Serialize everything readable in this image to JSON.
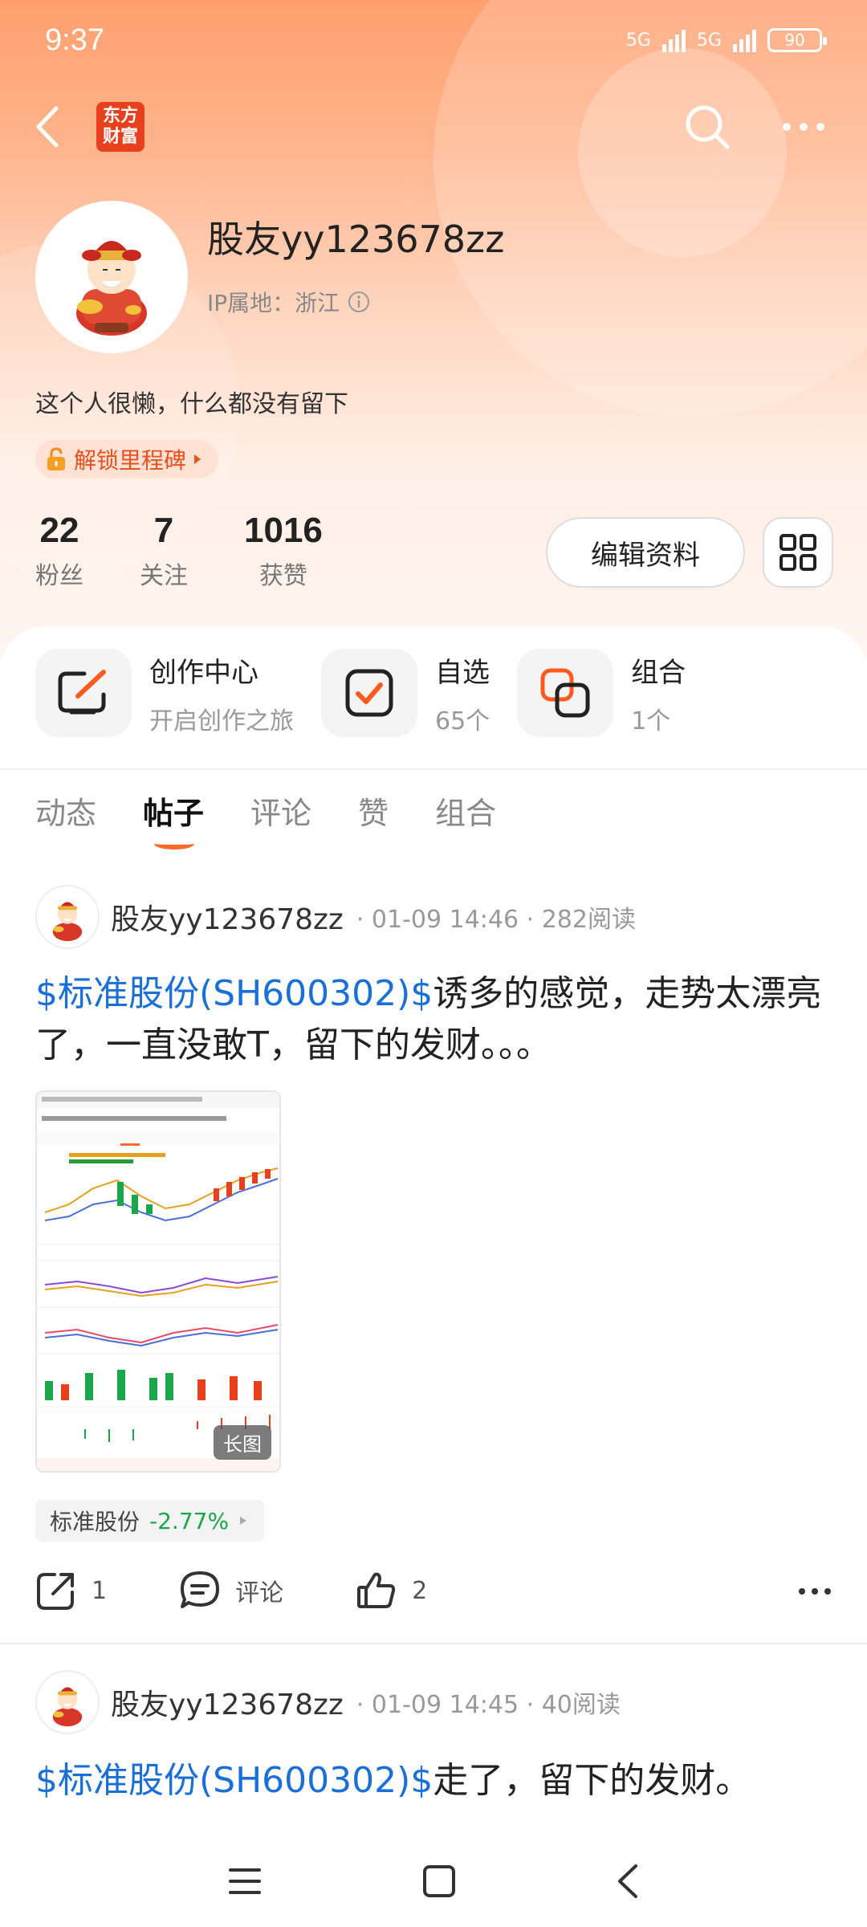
{
  "status_bar": {
    "time": "9:37",
    "net1": "5G",
    "net2": "5G",
    "battery": "90"
  },
  "nav": {
    "logo_line1": "东方",
    "logo_line2": "财富"
  },
  "profile": {
    "username": "股友yy123678zz",
    "ip_label": "IP属地：浙江",
    "bio": "这个人很懒，什么都没有留下",
    "milestone": "解锁里程碑"
  },
  "stats": [
    {
      "num": "22",
      "label": "粉丝"
    },
    {
      "num": "7",
      "label": "关注"
    },
    {
      "num": "1016",
      "label": "获赞"
    }
  ],
  "edit_label": "编辑资料",
  "quick": [
    {
      "title": "创作中心",
      "sub": "开启创作之旅",
      "icon": "pen-icon"
    },
    {
      "title": "自选",
      "sub": "65个",
      "icon": "checkbox-icon"
    },
    {
      "title": "组合",
      "sub": "1个",
      "icon": "combo-icon"
    }
  ],
  "tabs": [
    "动态",
    "帖子",
    "评论",
    "赞",
    "组合"
  ],
  "active_tab": "帖子",
  "posts": [
    {
      "author": "股友yy123678zz",
      "meta": "· 01-09 14:46 · 282阅读",
      "stock": "$标准股份(SH600302)$",
      "text": "诱多的感觉，走势太漂亮了，一直没敢T，留下的发财。。。",
      "image_tag": "长图",
      "chip_name": "标准股份",
      "chip_pct": "-2.77%",
      "shares": "1",
      "comment_label": "评论",
      "likes": "2"
    },
    {
      "author": "股友yy123678zz",
      "meta": "· 01-09 14:45 · 40阅读",
      "stock": "$标准股份(SH600302)$",
      "text": "走了，留下的发财。"
    }
  ],
  "colors": {
    "accent": "#ff6a2a",
    "link": "#1a6fd8",
    "down": "#1aa64b"
  }
}
